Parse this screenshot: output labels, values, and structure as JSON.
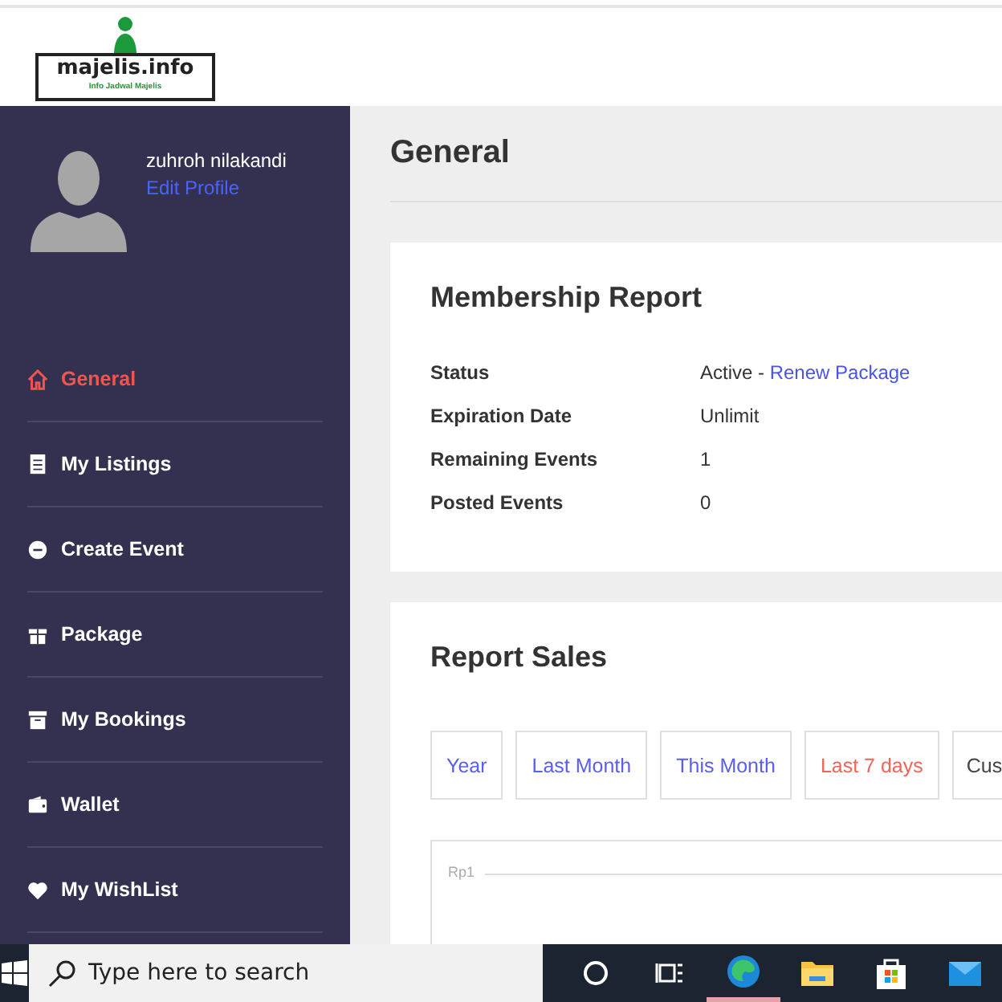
{
  "logo": {
    "title": "majelis.info",
    "tagline": "Info Jadwal Majelis"
  },
  "profile": {
    "name": "zuhroh nilakandi",
    "link": "Edit Profile"
  },
  "sidebar": {
    "items": [
      {
        "label": "General",
        "selected": true
      },
      {
        "label": "My Listings",
        "selected": false
      },
      {
        "label": "Create Event",
        "selected": false
      },
      {
        "label": "Package",
        "selected": false
      },
      {
        "label": "My Bookings",
        "selected": false
      },
      {
        "label": "Wallet",
        "selected": false
      },
      {
        "label": "My WishList",
        "selected": false
      }
    ]
  },
  "page_title": "General",
  "membership": {
    "title": "Membership Report",
    "rows": [
      {
        "label": "Status",
        "value": "Active - ",
        "link": "Renew Package"
      },
      {
        "label": "Expiration Date",
        "value": "Unlimit"
      },
      {
        "label": "Remaining Events",
        "value": "1"
      },
      {
        "label": "Posted Events",
        "value": "0"
      }
    ]
  },
  "sales": {
    "title": "Report Sales",
    "filters": [
      {
        "label": "Year",
        "kind": "period",
        "selected": false
      },
      {
        "label": "Last Month",
        "kind": "period",
        "selected": false
      },
      {
        "label": "This Month",
        "kind": "period",
        "selected": false
      },
      {
        "label": "Last 7 days",
        "kind": "period",
        "selected": true
      },
      {
        "label": "Cus",
        "kind": "custom",
        "selected": false
      }
    ],
    "chart": {
      "y_label": "Rp1"
    }
  },
  "taskbar": {
    "search": {
      "placeholder": "Type here to search"
    },
    "apps": [
      {
        "active": false
      },
      {
        "active": false
      },
      {
        "active": true
      },
      {
        "active": false
      },
      {
        "active": false
      },
      {
        "active": false
      }
    ]
  }
}
